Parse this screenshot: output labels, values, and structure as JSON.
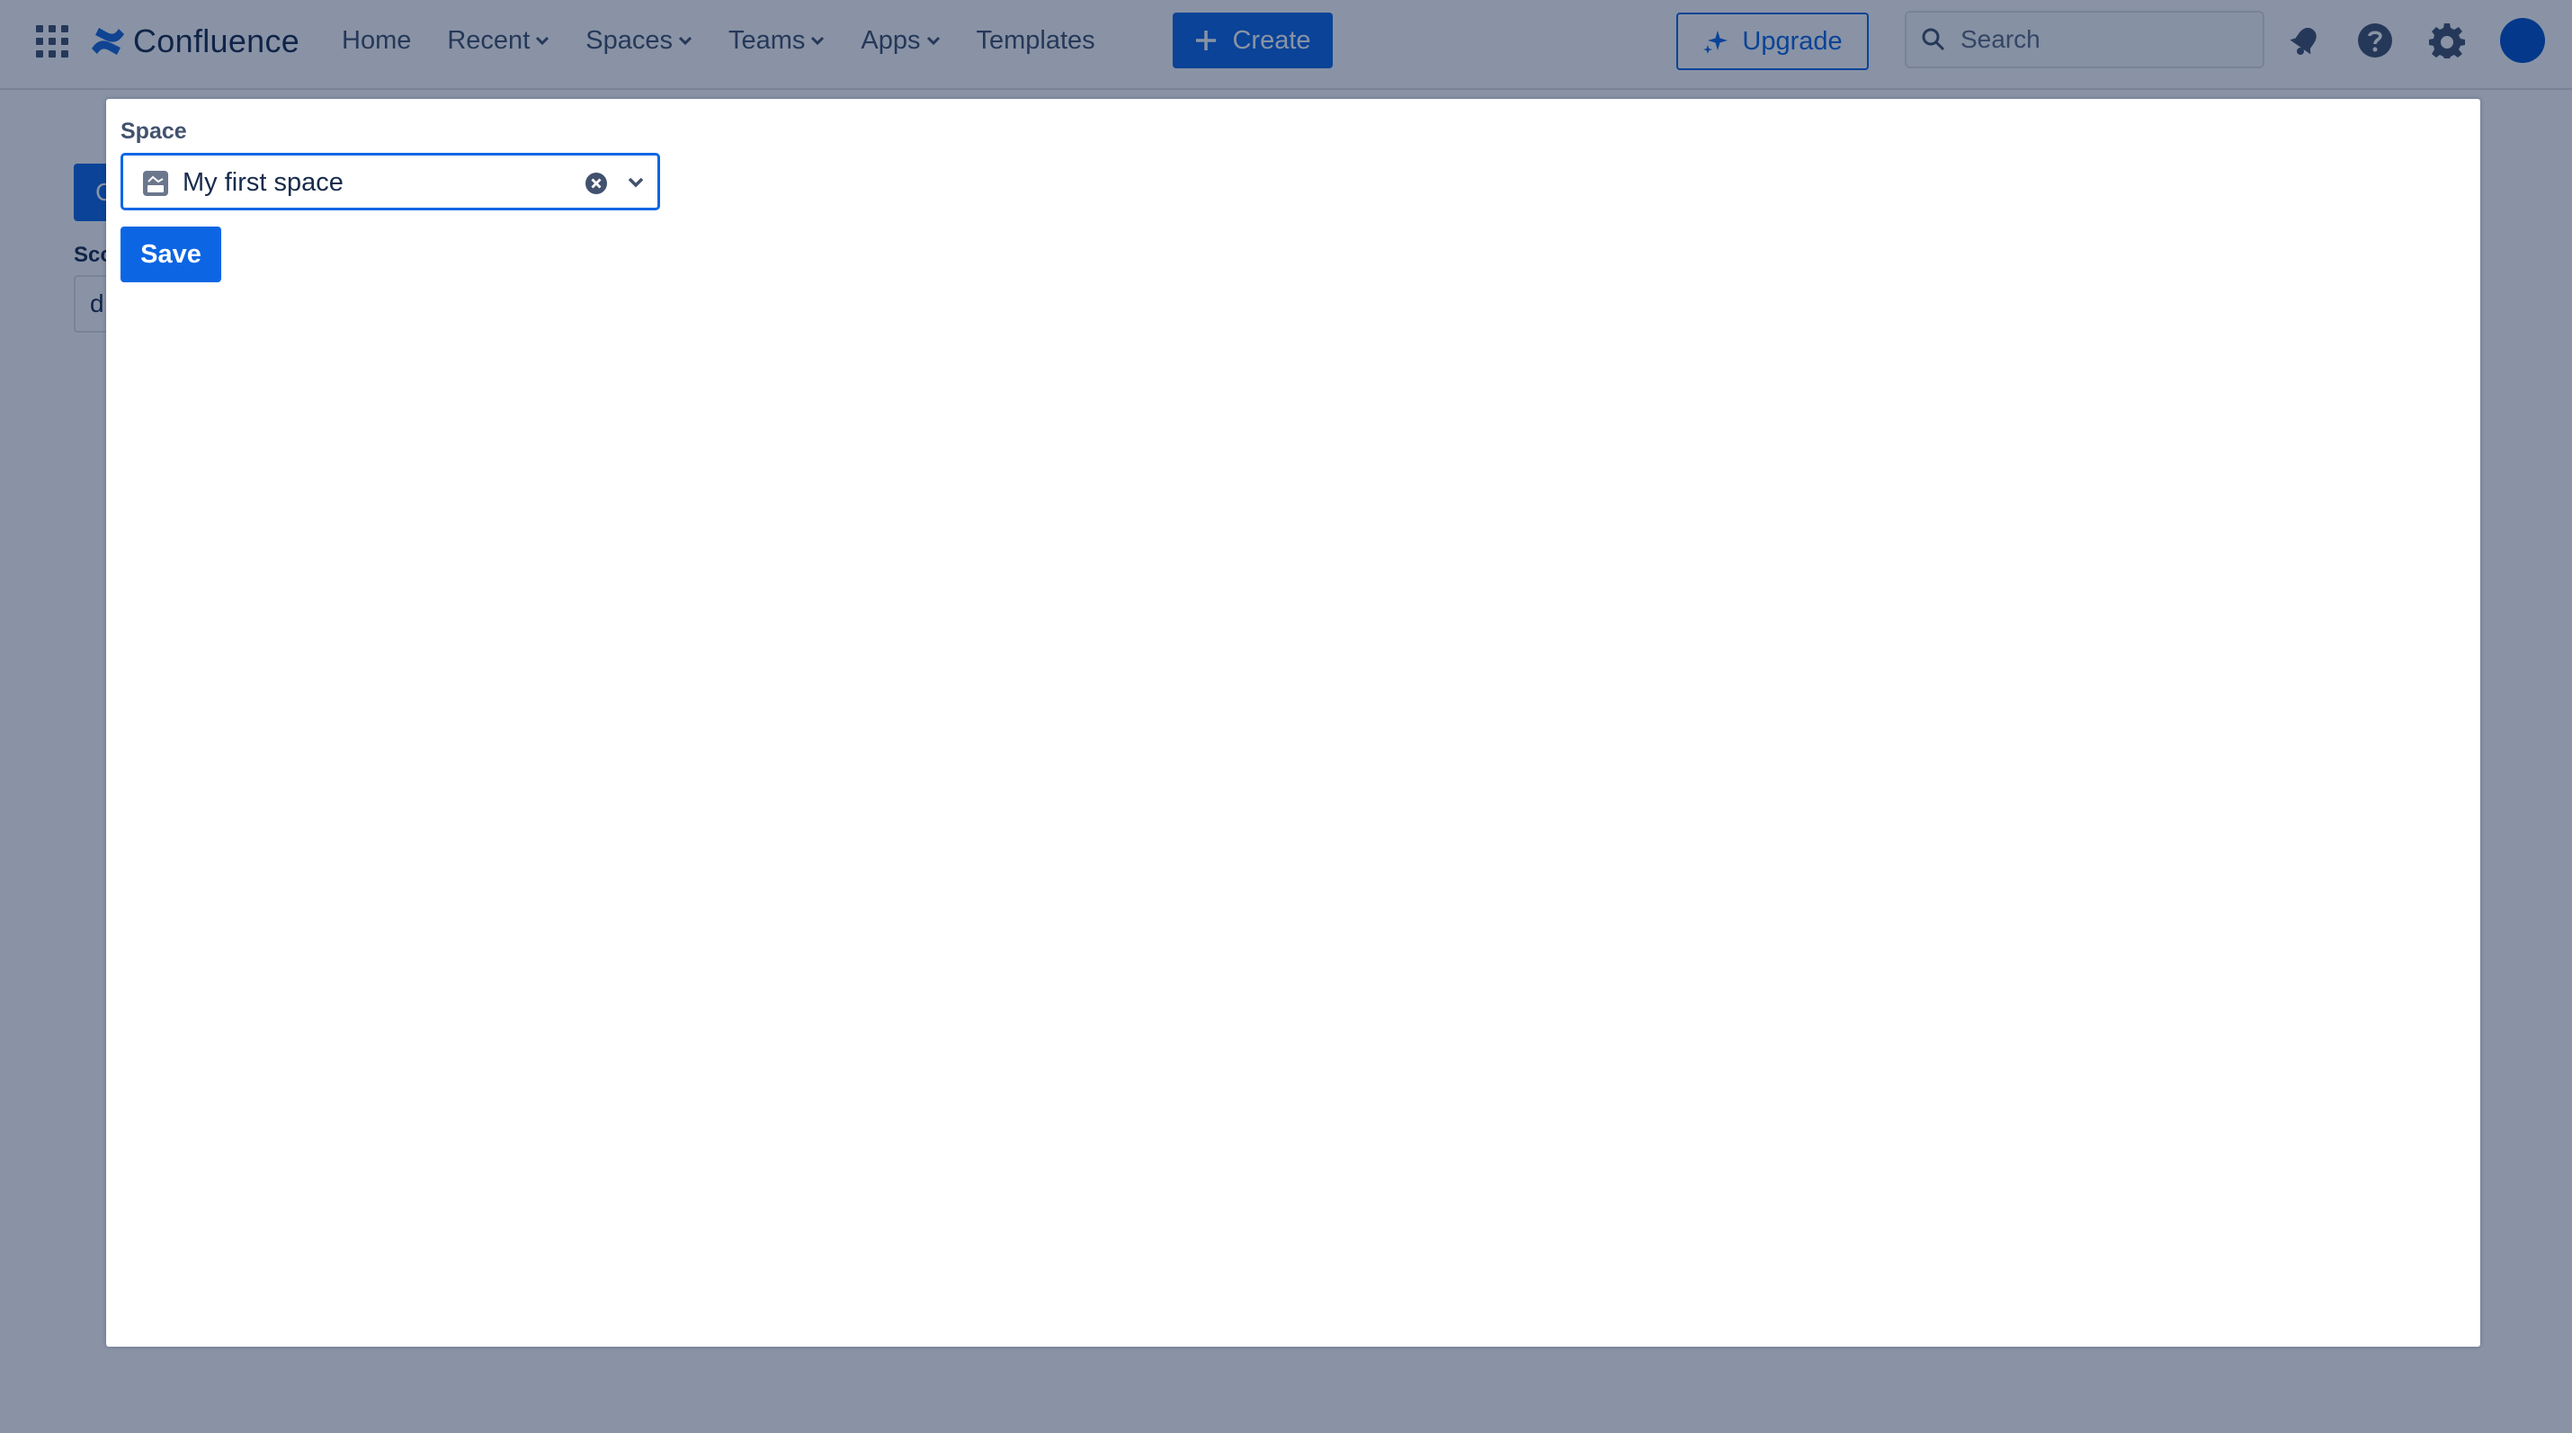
{
  "brand": {
    "name": "Confluence"
  },
  "nav": {
    "items": [
      {
        "label": "Home",
        "has_dropdown": false
      },
      {
        "label": "Recent",
        "has_dropdown": true
      },
      {
        "label": "Spaces",
        "has_dropdown": true
      },
      {
        "label": "Teams",
        "has_dropdown": true
      },
      {
        "label": "Apps",
        "has_dropdown": true
      },
      {
        "label": "Templates",
        "has_dropdown": false
      }
    ],
    "create_label": "Create",
    "upgrade_label": "Upgrade",
    "search_placeholder": "Search",
    "icons": [
      "app-switcher-icon",
      "notifications-icon",
      "help-icon",
      "settings-icon"
    ]
  },
  "background_page": {
    "button_text": "C",
    "label": "Sco",
    "input_value": "d"
  },
  "modal": {
    "space_label": "Space",
    "space_value": "My first space",
    "save_label": "Save"
  },
  "colors": {
    "brand_blue": "#0c66e4",
    "text_primary": "#172b4d",
    "text_secondary": "#42526e",
    "overlay": "rgba(9, 30, 66, 0.48)"
  }
}
